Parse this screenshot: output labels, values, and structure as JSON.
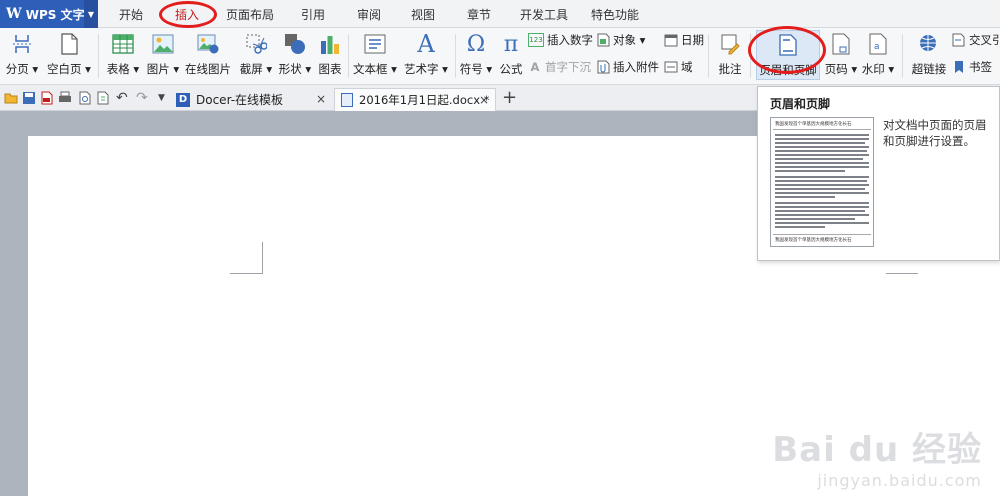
{
  "app": {
    "name": "WPS 文字",
    "logo": "W"
  },
  "menu_tabs": [
    "开始",
    "插入",
    "页面布局",
    "引用",
    "审阅",
    "视图",
    "章节",
    "开发工具",
    "特色功能"
  ],
  "ribbon": {
    "page_break": "分页",
    "blank_page": "空白页",
    "table": "表格",
    "picture": "图片",
    "online_picture": "在线图片",
    "screenshot": "截屏",
    "shape": "形状",
    "chart": "图表",
    "textbox": "文本框",
    "wordart": "艺术字",
    "symbol": "符号",
    "formula": "公式",
    "insert_number": "插入数字",
    "object": "对象",
    "date": "日期",
    "drop_cap": "首字下沉",
    "attachment": "插入附件",
    "field": "域",
    "comment": "批注",
    "header_footer": "页眉和页脚",
    "page_number": "页码",
    "watermark": "水印",
    "hyperlink": "超链接",
    "cross_ref": "交叉引",
    "bookmark": "书签"
  },
  "doc_tabs": [
    {
      "label": "Docer-在线模板",
      "close": "×"
    },
    {
      "label": "2016年1月1日起.docx *",
      "close": "×"
    }
  ],
  "new_tab": "+",
  "tooltip": {
    "title": "页眉和页脚",
    "description": "对文档中页面的页眉和页脚进行设置。",
    "preview_header": "我国发现首个单基因大规模地方化长石",
    "preview_footer": "我国发现首个单基因大规模地方化长石"
  },
  "watermark": {
    "brand": "Bai du 经验",
    "url": "jingyan.baidu.com"
  },
  "colors": {
    "accent": "#2d5fb8",
    "highlight_circle": "#e31c1c",
    "active_tab": "#c21d1d"
  }
}
